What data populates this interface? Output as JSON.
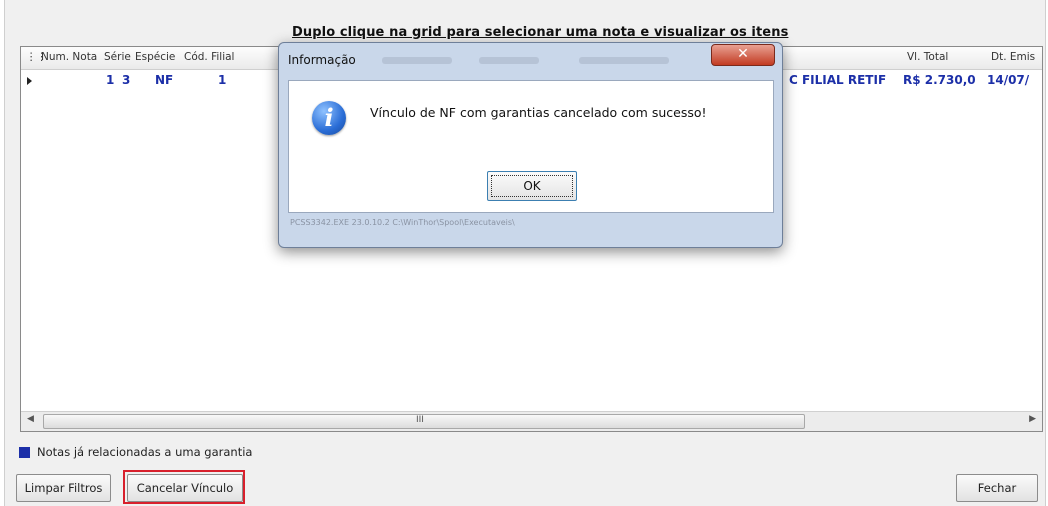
{
  "instruction": "Duplo clique na grid para selecionar uma nota e visualizar os itens",
  "grid": {
    "columns": [
      "Num. Nota",
      "Série",
      "Espécie",
      "Cód. Filial",
      "Vl. Total",
      "Dt. Emis"
    ],
    "row": {
      "num_nota": "1",
      "serie": "3",
      "especie": "NF",
      "cod_filial": "1",
      "filial_nome": "C FILIAL RETIF",
      "vl_total": "R$ 2.730,0",
      "dt_emissao": "14/07/"
    },
    "scrollbar_grip": "III"
  },
  "legend": {
    "label": "Notas já relacionadas a uma garantia",
    "color": "#1c2fa8"
  },
  "buttons": {
    "limpar_filtros": "Limpar Filtros",
    "cancelar_vinculo": "Cancelar Vínculo",
    "fechar": "Fechar"
  },
  "dialog": {
    "title": "Informação",
    "close_glyph": "✕",
    "message": "Vínculo de NF com garantias cancelado com sucesso!",
    "ok_label": "OK",
    "footer": "PCSS3342.EXE 23.0.10.2 C:\\WinThor\\Spool\\Executaveis\\"
  },
  "icons": {
    "info": "information-icon",
    "close": "close-icon",
    "row_pointer": "row-pointer-icon"
  }
}
